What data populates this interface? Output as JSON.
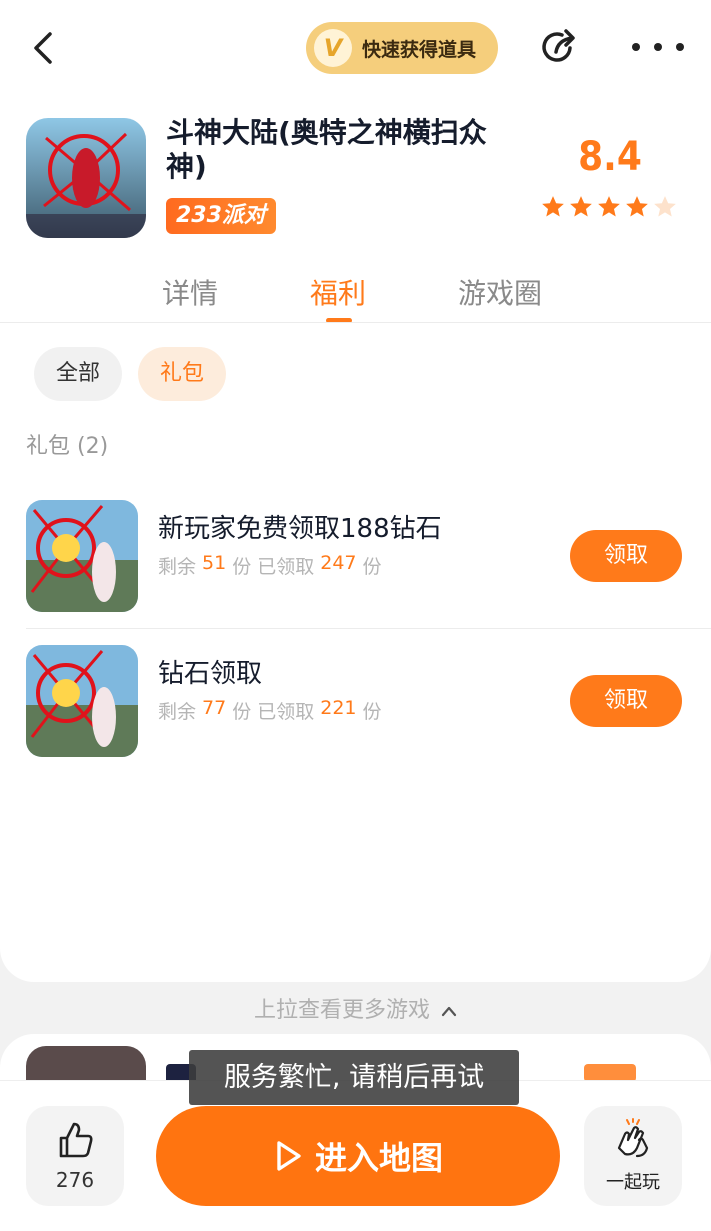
{
  "top_bar": {
    "vip_badge_letter": "V",
    "vip_label": "快速获得道具",
    "icons": [
      "back-icon",
      "share-icon",
      "more-icon"
    ]
  },
  "game": {
    "title": "斗神大陆(奥特之神横扫众神)",
    "tag": "233派对",
    "score": "8.4",
    "rating_stars": 4.5
  },
  "tabs": [
    {
      "label": "详情",
      "active": false
    },
    {
      "label": "福利",
      "active": true
    },
    {
      "label": "游戏圈",
      "active": false
    }
  ],
  "filters": [
    {
      "label": "全部",
      "active": false
    },
    {
      "label": "礼包",
      "active": true
    }
  ],
  "section": {
    "label": "礼包 (2)"
  },
  "gifts": [
    {
      "name": "新玩家免费领取188钻石",
      "remaining_prefix": "剩余",
      "remaining": "51",
      "unit": "份",
      "claimed_prefix": "已领取",
      "claimed": "247",
      "claimed_unit": "份",
      "button": "领取"
    },
    {
      "name": "钻石领取",
      "remaining_prefix": "剩余",
      "remaining": "77",
      "unit": "份",
      "claimed_prefix": "已领取",
      "claimed": "221",
      "claimed_unit": "份",
      "button": "领取"
    }
  ],
  "pull_up": {
    "label": "上拉查看更多游戏"
  },
  "bottom_bar": {
    "like_count": "276",
    "enter_label": "进入地图",
    "play_label": "一起玩"
  },
  "toast": {
    "message": "服务繁忙, 请稍后再试"
  },
  "colors": {
    "accent": "#ff7a1a",
    "vip_gold": "#f5ce7c",
    "chip_active_bg": "#fdecdc"
  }
}
